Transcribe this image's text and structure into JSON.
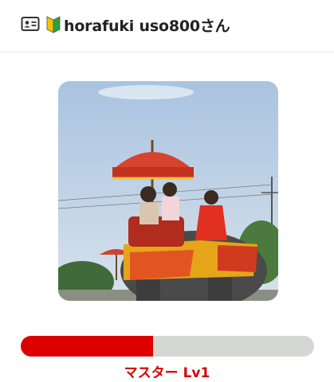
{
  "header": {
    "id_icon": "id-card-icon",
    "beginner_icon": "beginner-mark-icon",
    "username": "horafuki uso800さん"
  },
  "profile_photo": {
    "description_icon": "profile-photo"
  },
  "level": {
    "label": "マスター Lv1",
    "progress_fraction": 0.45,
    "fill_color": "#dd0000",
    "track_color": "#d4d8d4"
  }
}
